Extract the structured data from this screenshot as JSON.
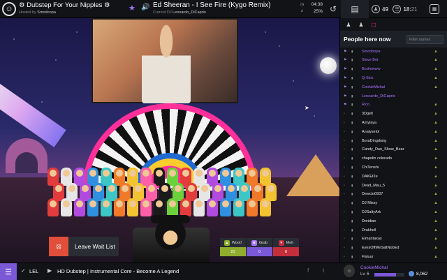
{
  "topbar": {
    "room_name": "⚙ Dubstep For Your Nipples ⚙",
    "hosted_by_label": "Hosted by",
    "host": "Smodoopa",
    "song_title": "Ed Sheeran - I See Fire (Kygo Remix)",
    "current_dj_label": "Current DJ",
    "current_dj": "Lenoardo_DiCaprio",
    "time_remaining": "04:38",
    "volume": "25%",
    "users_count": "49",
    "waitlist_position": "18",
    "waitlist_total": "21"
  },
  "sidebar": {
    "header": "People here now",
    "filter_placeholder": "Filter names",
    "users": [
      {
        "name": "Smodoopa",
        "staff": true,
        "woot": true
      },
      {
        "name": "Slave Bot",
        "staff": true,
        "woot": true
      },
      {
        "name": "Bodrewww",
        "staff": true,
        "woot": true
      },
      {
        "name": "Q-Sick",
        "staff": true,
        "woot": true
      },
      {
        "name": "CookieMichal",
        "staff": true,
        "woot": true
      },
      {
        "name": "Lenoardo_DiCaprio",
        "staff": true,
        "woot": false
      },
      {
        "name": "Rico",
        "staff": true,
        "woot": true
      },
      {
        "name": "3Dgelt",
        "staff": false,
        "woot": true
      },
      {
        "name": "Amylaya",
        "staff": false,
        "woot": true
      },
      {
        "name": "Analyselol",
        "staff": false,
        "woot": true
      },
      {
        "name": "BoraDingdong",
        "staff": false,
        "woot": true
      },
      {
        "name": "Candy_Dan_Show_Bear",
        "staff": false,
        "woot": true
      },
      {
        "name": "chapolin colorado",
        "staff": false,
        "woot": true
      },
      {
        "name": "ChiTenshi",
        "staff": false,
        "woot": true
      },
      {
        "name": "DAKEt2e",
        "staff": false,
        "woot": true
      },
      {
        "name": "Dead_Mau_5",
        "staff": false,
        "woot": true
      },
      {
        "name": "Dewclo0937",
        "staff": false,
        "woot": true
      },
      {
        "name": "DJ Missy",
        "staff": false,
        "woot": true
      },
      {
        "name": "DJSaltyArk",
        "staff": false,
        "woot": true
      },
      {
        "name": "Doridian",
        "staff": false,
        "woot": true
      },
      {
        "name": "Drakhell",
        "staff": false,
        "woot": true
      },
      {
        "name": "Elmantaxas",
        "staff": false,
        "woot": true
      },
      {
        "name": "EyesOffMeSaltNobEd",
        "staff": false,
        "woot": true
      },
      {
        "name": "Fixiuur",
        "staff": false,
        "woot": true
      }
    ]
  },
  "stage": {
    "leave_waitlist_label": "Leave Wait List",
    "votes": {
      "woot_label": "Woot!",
      "woot_count": "21",
      "grab_label": "Grab",
      "grab_count": "0",
      "meh_label": "Meh",
      "meh_count": "0"
    }
  },
  "bottombar": {
    "playlist_name": "LEL",
    "next_song": "HD Dubstep | Instrumental Core - Become A Legend",
    "me_name": "CookieMichal",
    "me_level": "Lv. 6",
    "xp_progress": 0.72,
    "pp": "8,062"
  },
  "colors": {
    "accent": "#7a58d6",
    "staff": "#aa74ff",
    "woot": "#90ad2f",
    "meh": "#c42e3b",
    "leave": "#e14f3a"
  }
}
